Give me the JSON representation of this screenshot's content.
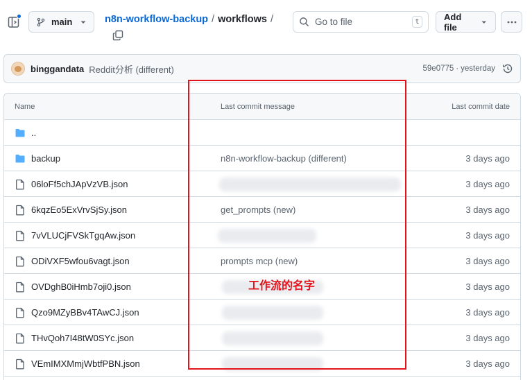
{
  "header": {
    "branch": "main",
    "repo": "n8n-workflow-backup",
    "separator": "/",
    "directory": "workflows",
    "goto_placeholder": "Go to file",
    "goto_shortcut": "t",
    "add_file_label": "Add file"
  },
  "latest_commit": {
    "author": "binggandata",
    "message": "Reddit分析 (different)",
    "hash": "59e0775",
    "separator": "·",
    "time": "yesterday"
  },
  "table": {
    "columns": {
      "name": "Name",
      "message": "Last commit message",
      "date": "Last commit date"
    },
    "rows": [
      {
        "name": "..",
        "type": "parent",
        "message": "",
        "date": ""
      },
      {
        "name": "backup",
        "type": "folder",
        "message": "n8n-workflow-backup (different)",
        "date": "3 days ago"
      },
      {
        "name": "06loFf5chJApVzVB.json",
        "type": "file",
        "message": "",
        "date": "3 days ago"
      },
      {
        "name": "6kqzEo5ExVrvSjSy.json",
        "type": "file",
        "message": "get_prompts (new)",
        "date": "3 days ago"
      },
      {
        "name": "7vVLUCjFVSkTgqAw.json",
        "type": "file",
        "message": "",
        "date": "3 days ago"
      },
      {
        "name": "ODiVXF5wfou6vagt.json",
        "type": "file",
        "message": "prompts mcp (new)",
        "date": "3 days ago"
      },
      {
        "name": "OVDghB0iHmb7oji0.json",
        "type": "file",
        "message": "",
        "date": "3 days ago"
      },
      {
        "name": "Qzo9MZyBBv4TAwCJ.json",
        "type": "file",
        "message": "",
        "date": "3 days ago"
      },
      {
        "name": "THvQoh7I48tW0SYc.json",
        "type": "file",
        "message": "",
        "date": "3 days ago"
      },
      {
        "name": "VEmIMXMmjWbtfPBN.json",
        "type": "file",
        "message": "",
        "date": "3 days ago"
      }
    ]
  },
  "annotation": {
    "text": "工作流的名字",
    "color": "#e3121b"
  },
  "colors": {
    "link": "#0969da",
    "folder": "#54aeff",
    "muted": "#59636e",
    "border": "#d1d9e0"
  }
}
